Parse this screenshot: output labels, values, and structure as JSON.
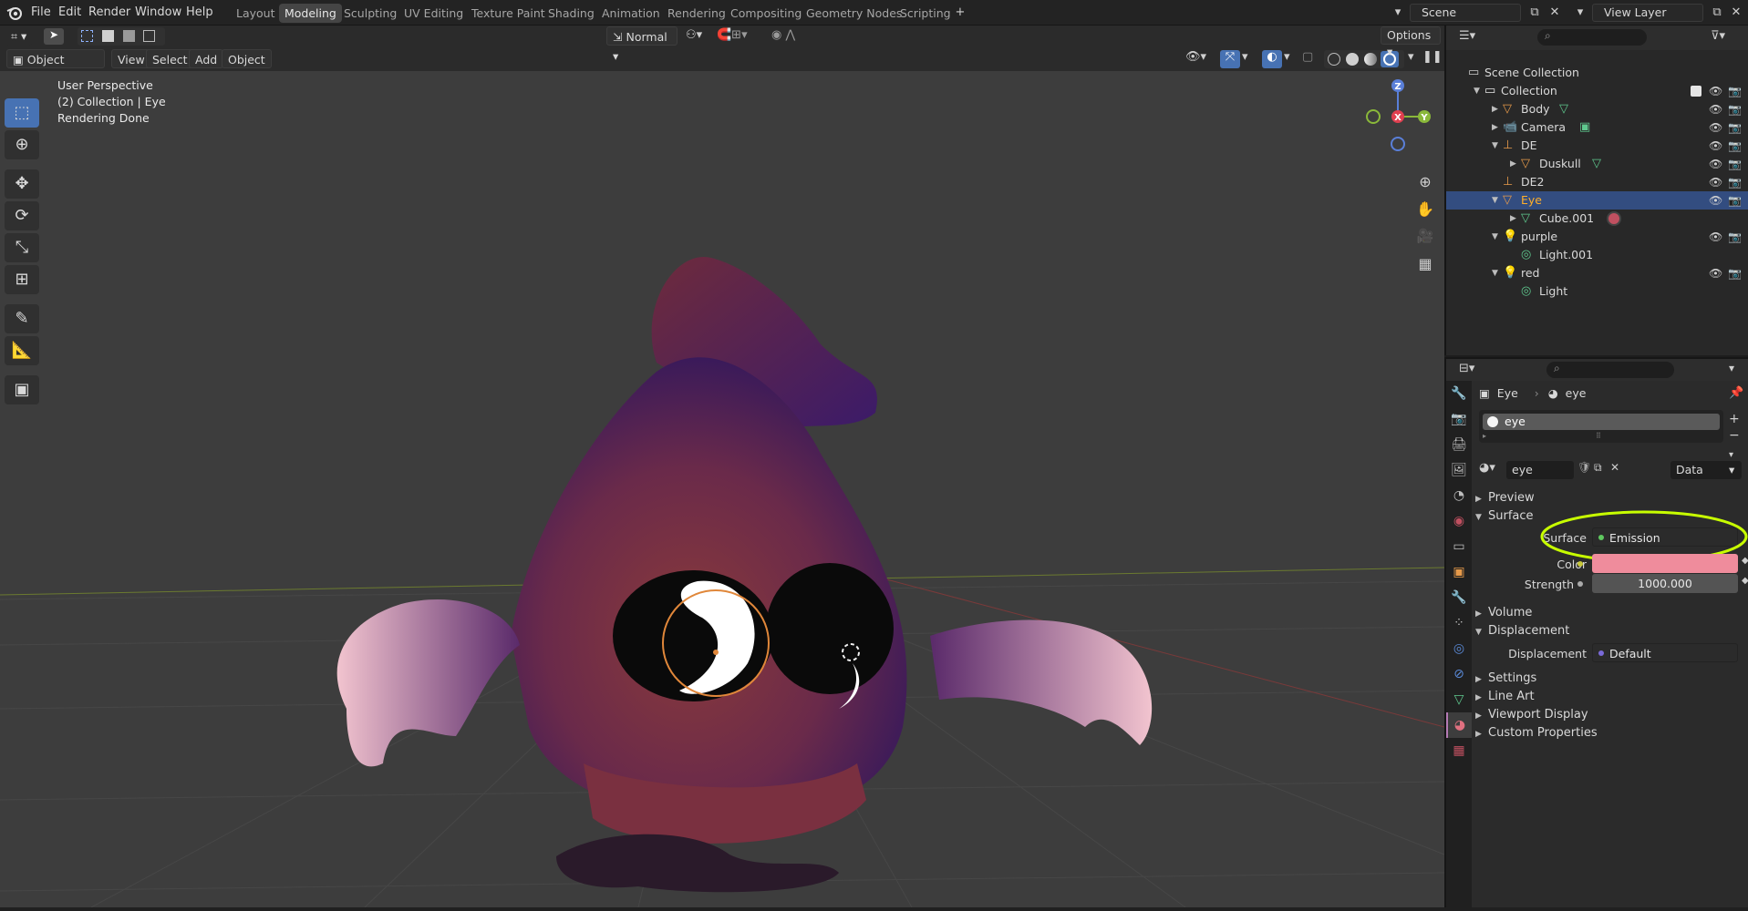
{
  "menu": {
    "items": [
      "File",
      "Edit",
      "Render",
      "Window",
      "Help"
    ]
  },
  "workspaces": [
    "Layout",
    "Modeling",
    "Sculpting",
    "UV Editing",
    "Texture Paint",
    "Shading",
    "Animation",
    "Rendering",
    "Compositing",
    "Geometry Nodes",
    "Scripting"
  ],
  "active_workspace": "Modeling",
  "scene": {
    "name": "Scene",
    "view_layer": "View Layer"
  },
  "header": {
    "mode": "Object Mode",
    "menus": [
      "View",
      "Select",
      "Add",
      "Object"
    ],
    "transform_orientation": "Normal",
    "options": "Options"
  },
  "viewport": {
    "overlay_lines": [
      "User Perspective",
      "(2) Collection | Eye",
      "Rendering Done"
    ],
    "gizmo": {
      "z": "Z",
      "x": "X",
      "y": "Y"
    }
  },
  "outliner": {
    "rows": [
      {
        "label": "Scene Collection",
        "icon": "scene-collection-icon"
      },
      {
        "label": "Collection",
        "icon": "collection-icon"
      },
      {
        "label": "Body",
        "icon": "mesh-object-icon"
      },
      {
        "label": "Camera",
        "icon": "camera-icon"
      },
      {
        "label": "DE",
        "icon": "empty-object-icon"
      },
      {
        "label": "Duskull",
        "icon": "mesh-object-icon"
      },
      {
        "label": "DE2",
        "icon": "empty-object-icon"
      },
      {
        "label": "Eye",
        "icon": "mesh-object-icon"
      },
      {
        "label": "Cube.001",
        "icon": "mesh-data-icon"
      },
      {
        "label": "purple",
        "icon": "light-object-icon"
      },
      {
        "label": "Light.001",
        "icon": "light-data-icon"
      },
      {
        "label": "red",
        "icon": "light-object-icon"
      },
      {
        "label": "Light",
        "icon": "light-data-icon"
      }
    ],
    "selected": "Eye"
  },
  "properties": {
    "breadcrumb_object": "Eye",
    "breadcrumb_material": "eye",
    "slot_name": "eye",
    "material_name": "eye",
    "link": "Data",
    "panels": {
      "preview": "Preview",
      "surface": "Surface",
      "volume": "Volume",
      "displacement": "Displacement",
      "settings": "Settings",
      "line_art": "Line Art",
      "viewport_display": "Viewport Display",
      "custom_properties": "Custom Properties"
    },
    "surface_label": "Surface",
    "surface_value": "Emission",
    "color_label": "Color",
    "color_value": "#ef8c9c",
    "strength_label": "Strength",
    "strength_value": "1000.000",
    "displacement_label": "Displacement",
    "displacement_value": "Default"
  },
  "colors": {
    "accent": "#4772b3",
    "selection": "#334d80",
    "annotation": "#c8ff00"
  }
}
